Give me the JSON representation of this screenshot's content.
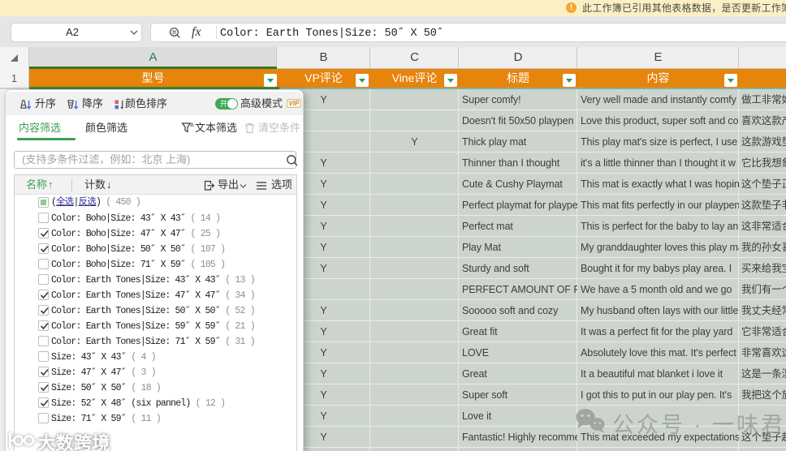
{
  "notification": {
    "icon_glyph": "!",
    "text": "此工作簿已引用其他表格数据，是否更新工作簿"
  },
  "formula_bar": {
    "cell_ref": "A2",
    "fx_label": "fx",
    "formula": "Color: Earth Tones|Size: 50″ X 50″"
  },
  "sheet": {
    "column_letters": [
      "A",
      "B",
      "C",
      "D",
      "E"
    ],
    "selected_column": "A",
    "row_number": "1",
    "header_cells": [
      "型号",
      "VP评论",
      "Vine评论",
      "标题",
      "内容"
    ],
    "rows": [
      {
        "b": "Y",
        "c": "",
        "d": "Super comfy!",
        "e": "Very well made and instantly comfy",
        "f": "做工非常好"
      },
      {
        "b": "",
        "c": "",
        "d": "Doesn't fit 50x50 playpen",
        "e": "Love this product, super soft and co",
        "f": "喜欢这款产"
      },
      {
        "b": "",
        "c": "Y",
        "d": "Thick play mat",
        "e": "This play mat's size is perfect, I use",
        "f": "这款游戏垫"
      },
      {
        "b": "Y",
        "c": "",
        "d": "Thinner than I thought",
        "e": "it's a little thinner than I thought it w",
        "f": "它比我想象"
      },
      {
        "b": "Y",
        "c": "",
        "d": "Cute & Cushy Playmat",
        "e": "This mat is exactly what I was hoping",
        "f": "这个垫子正"
      },
      {
        "b": "Y",
        "c": "",
        "d": "Perfect playmat for playpen",
        "e": "This mat fits perfectly in our playpen",
        "f": "这款垫子非"
      },
      {
        "b": "Y",
        "c": "",
        "d": "Perfect mat",
        "e": "This is perfect for the baby to lay an",
        "f": "这非常适合"
      },
      {
        "b": "Y",
        "c": "",
        "d": "Play Mat",
        "e": "My granddaughter loves this play ma",
        "f": "我的孙女喜"
      },
      {
        "b": "Y",
        "c": "",
        "d": "Sturdy and soft",
        "e": "Bought it for my babys play area. I",
        "f": "买来给我宝"
      },
      {
        "b": "",
        "c": "",
        "d": "PERFECT AMOUNT OF PA",
        "e": "We have a 5 month old and we go",
        "f": "我们有一个"
      },
      {
        "b": "Y",
        "c": "",
        "d": "Sooooo soft and cozy",
        "e": "My husband often lays with our little",
        "f": "我丈夫经常"
      },
      {
        "b": "Y",
        "c": "",
        "d": "Great fit",
        "e": "It was a perfect fit for the play yard",
        "f": "它非常适合"
      },
      {
        "b": "Y",
        "c": "",
        "d": "LOVE",
        "e": "Absolutely love this mat. It's perfect",
        "f": "非常喜欢这"
      },
      {
        "b": "Y",
        "c": "",
        "d": "Great",
        "e": "It a beautiful mat blanket i love it",
        "f": "这是一条漂"
      },
      {
        "b": "Y",
        "c": "",
        "d": "Super soft",
        "e": "I got this to put in our play pen. It's",
        "f": "我把这个放"
      },
      {
        "b": "Y",
        "c": "",
        "d": "Love it",
        "e": "",
        "f": ""
      },
      {
        "b": "Y",
        "c": "",
        "d": "Fantastic! Highly recommend",
        "e": "This mat exceeded my expectations",
        "f": "这个垫子超"
      }
    ]
  },
  "filter_panel": {
    "toolbar": {
      "sort_asc": "升序",
      "sort_desc": "降序",
      "color_sort": "颜色排序",
      "toggle_state": "开",
      "advanced_mode": "高级模式",
      "vip": "VIP"
    },
    "tabs": {
      "content_filter": "内容筛选",
      "color_filter": "颜色筛选",
      "text_filter": "文本筛选",
      "clear_conditions": "清空条件"
    },
    "search": {
      "placeholder": "(支持多条件过滤，例如：北京 上海)"
    },
    "list": {
      "name_header": "名称",
      "name_sort_icon": "↑",
      "count_header": "计数",
      "count_sort_icon": "↓",
      "export_label": "导出",
      "options_label": "选项",
      "select_all": {
        "label": "(全选|反选)",
        "link_left": "全选",
        "link_right": "反选",
        "count": "450"
      },
      "items": [
        {
          "label": "Color: Boho|Size: 43″ X 43″",
          "count": "14",
          "checked": false
        },
        {
          "label": "Color: Boho|Size: 47″ X 47″",
          "count": "25",
          "checked": true
        },
        {
          "label": "Color: Boho|Size: 50″ X 50″",
          "count": "107",
          "checked": true
        },
        {
          "label": "Color: Boho|Size: 71″ X 59″",
          "count": "105",
          "checked": false
        },
        {
          "label": "Color: Earth Tones|Size: 43″ X 43″",
          "count": "13",
          "checked": false
        },
        {
          "label": "Color: Earth Tones|Size: 47″ X 47″",
          "count": "34",
          "checked": true
        },
        {
          "label": "Color: Earth Tones|Size: 50″ X 50″",
          "count": "52",
          "checked": true
        },
        {
          "label": "Color: Earth Tones|Size: 59″ X 59″",
          "count": "21",
          "checked": true
        },
        {
          "label": "Color: Earth Tones|Size: 71″ X 59″",
          "count": "31",
          "checked": false
        },
        {
          "label": "Size: 43″ X 43″",
          "count": "4",
          "checked": false
        },
        {
          "label": "Size: 47″ X 47″",
          "count": "3",
          "checked": true
        },
        {
          "label": "Size: 50″ X 50″",
          "count": "18",
          "checked": true
        },
        {
          "label": "Size: 52″ X 48″ (six pannel)",
          "count": "12",
          "checked": true
        },
        {
          "label": "Size: 71″ X 59″",
          "count": "11",
          "checked": false
        }
      ]
    }
  },
  "watermarks": {
    "left": "大数跨境",
    "right": "公众号 · 一味君"
  }
}
